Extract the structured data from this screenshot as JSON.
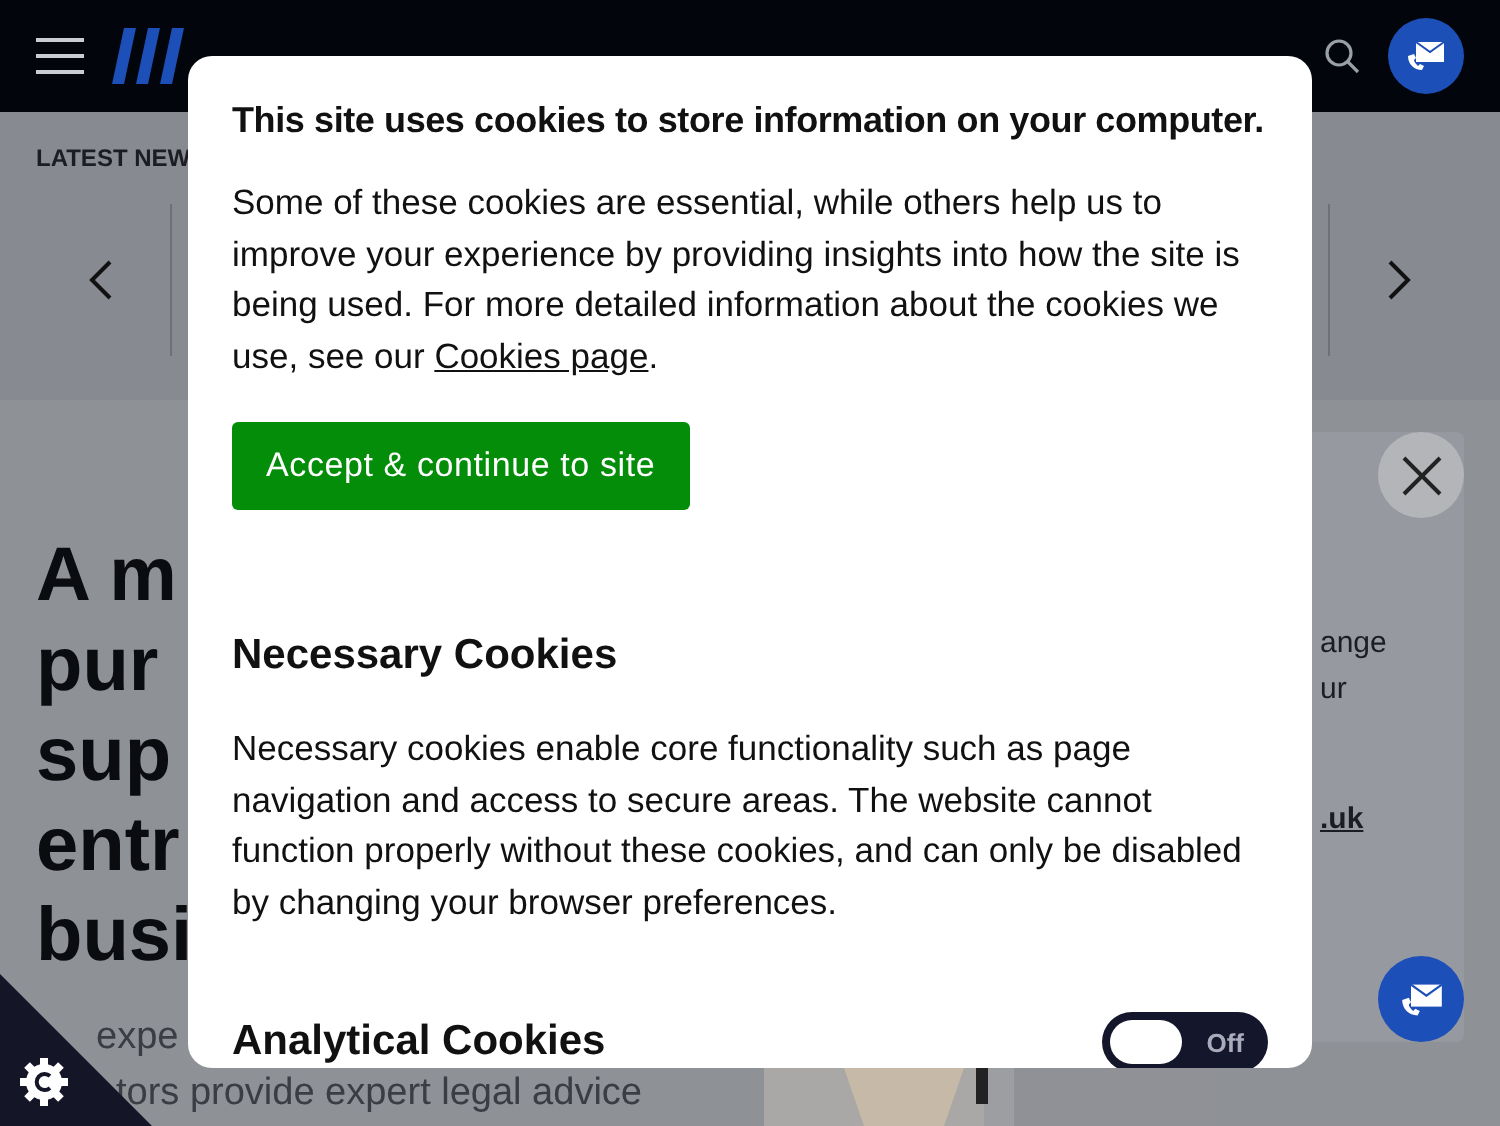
{
  "news": {
    "label": "LATEST NEW"
  },
  "hero": {
    "heading_lines": [
      "A m",
      "pur",
      "sup",
      "entr",
      "busi"
    ],
    "intro_lines": [
      "expe",
      "tors provide expert legal advice"
    ]
  },
  "side_card": {
    "lines": [
      "ange",
      "ur"
    ],
    "link": ".uk"
  },
  "cookie_dialog": {
    "title": "This site uses cookies to store information on your computer.",
    "intro": "Some of these cookies are essential, while others help us to improve your experience by providing insights into how the site is being used. For more detailed information about the cookies we use, see our",
    "link": "Cookies page",
    "intro_end": ".",
    "accept_button": "Accept & continue to site",
    "sections": [
      {
        "title": "Necessary Cookies",
        "text": "Necessary cookies enable core functionality such as page navigation and access to secure areas. The website cannot function properly without these cookies, and can only be disabled by changing your browser preferences."
      },
      {
        "title": "Analytical Cookies",
        "toggle": {
          "on": false,
          "label": "Off"
        }
      }
    ]
  }
}
